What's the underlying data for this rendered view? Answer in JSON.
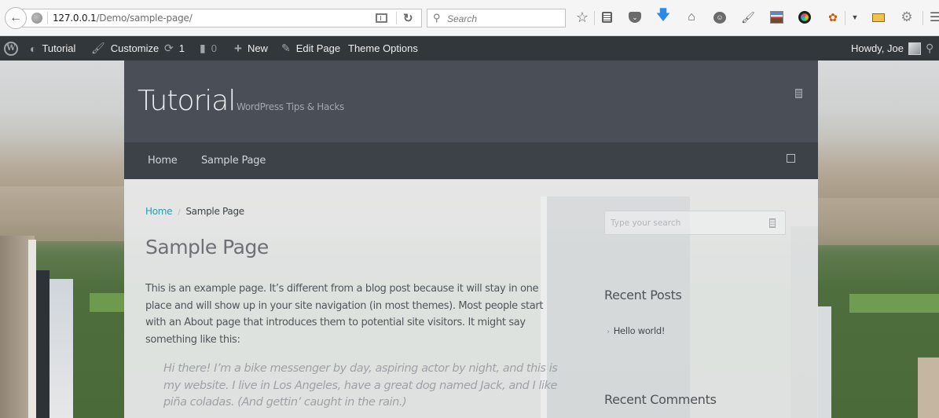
{
  "browser": {
    "url_host": "127.0.0.1",
    "url_path": "/Demo/sample-page/",
    "search_placeholder": "Search",
    "toolbar_icons": [
      "bookmark-star-icon",
      "reading-list-icon",
      "pocket-icon",
      "download-icon",
      "home-icon",
      "chat-icon",
      "eyedropper-icon",
      "screenshot-icon",
      "color-picker-icon",
      "firebug-icon",
      "dropdown-icon",
      "ruler-icon",
      "settings-gear-icon",
      "menu-icon"
    ]
  },
  "admin_bar": {
    "site_name": "Tutorial",
    "customize": "Customize",
    "updates_count": "1",
    "comments_count": "0",
    "new_label": "New",
    "edit_page": "Edit Page",
    "theme_options": "Theme Options",
    "howdy": "Howdy, Joe"
  },
  "site": {
    "title": "Tutorial",
    "tagline": "WordPress Tips & Hacks",
    "nav": [
      {
        "label": "Home"
      },
      {
        "label": "Sample Page"
      }
    ]
  },
  "breadcrumb": {
    "home": "Home",
    "separator": "/",
    "current": "Sample Page"
  },
  "page": {
    "title": "Sample Page",
    "body": "This is an example page. It’s different from a blog post because it will stay in one place and will show up in your site navigation (in most themes). Most people start with an About page that introduces them to potential site visitors. It might say something like this:",
    "quote": "Hi there! I’m a bike messenger by day, aspiring actor by night, and this is my website. I live in Los Angeles, have a great dog named Jack, and I like piña coladas. (And gettin’ caught in the rain.)"
  },
  "sidebar": {
    "search_placeholder": "Type your search",
    "recent_posts_title": "Recent Posts",
    "recent_posts": [
      {
        "label": "Hello world!"
      }
    ],
    "recent_comments_title": "Recent Comments"
  },
  "colors": {
    "admin_bar_bg": "#32373c",
    "header_bg": "#4a4f57",
    "nav_bg": "#3d4249",
    "link_accent": "#2c9cac"
  }
}
